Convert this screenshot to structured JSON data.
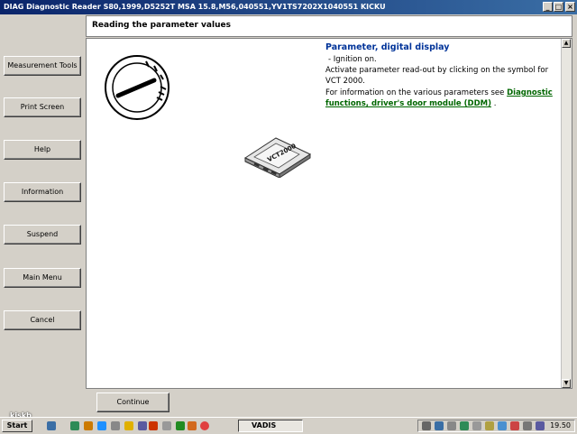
{
  "window": {
    "title": "DIAG Diagnostic Reader S80,1999,D5252T MSA 15.8,M56,040551,YV1TS7202X1040551 KICKU",
    "min_label": "_",
    "max_label": "□",
    "close_label": "×"
  },
  "header": {
    "title": "Reading the parameter values"
  },
  "sidebar": {
    "items": [
      {
        "label": "Measurement Tools"
      },
      {
        "label": "Print Screen"
      },
      {
        "label": "Help"
      },
      {
        "label": "Information"
      },
      {
        "label": "Suspend"
      },
      {
        "label": "Main Menu"
      },
      {
        "label": "Cancel"
      }
    ]
  },
  "content": {
    "info_title": "Parameter, digital display",
    "bullet": "Ignition on.",
    "line1": "Activate parameter read-out by clicking on the symbol for",
    "line2": "VCT 2000.",
    "line3_prefix": "For information on the various parameters see",
    "link1": "Diagnostic",
    "link2": "functions, driver's door module (DDM)",
    "line4_suffix": " .",
    "device_label": "VCT2000"
  },
  "footer": {
    "continue_label": "Continue"
  },
  "taskbar": {
    "start_label": "Start",
    "task_label": "VADIS",
    "clock": "19.50",
    "desktop_label": "kiskb"
  },
  "colors": {
    "titlebar": "#0a246a",
    "info_title": "#003399",
    "link": "#006600"
  }
}
